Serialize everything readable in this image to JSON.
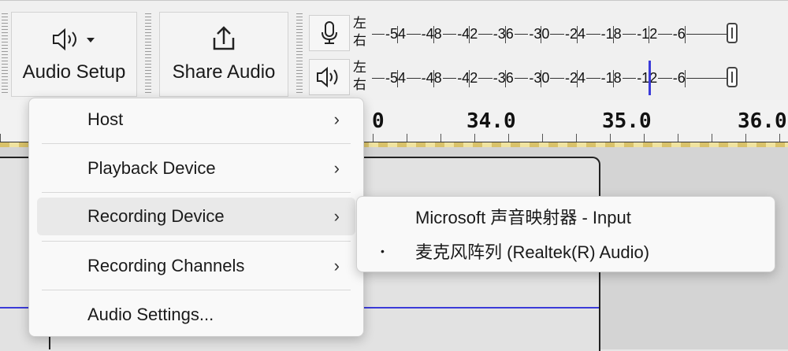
{
  "toolbar": {
    "audio_setup_label": "Audio Setup",
    "share_audio_label": "Share Audio",
    "caret": "▾"
  },
  "meters": {
    "recording": {
      "icon": "microphone-icon",
      "channels": [
        "左",
        "右"
      ]
    },
    "playback": {
      "icon": "speaker-icon",
      "channels": [
        "左",
        "右"
      ]
    },
    "scale_labels": [
      "-54",
      "-48",
      "-42",
      "-36",
      "-30",
      "-24",
      "-18",
      "-12",
      "-6"
    ],
    "playback_level_db": -12
  },
  "ruler": {
    "labels": [
      "0",
      "34.0",
      "35.0",
      "36.0"
    ]
  },
  "audio_setup_menu": {
    "items": [
      {
        "label": "Host",
        "submenu": true
      },
      {
        "label": "Playback Device",
        "submenu": true
      },
      {
        "label": "Recording Device",
        "submenu": true,
        "highlighted": true
      },
      {
        "label": "Recording Channels",
        "submenu": true
      },
      {
        "label": "Audio Settings...",
        "submenu": false
      }
    ],
    "arrow": "›"
  },
  "recording_device_submenu": {
    "items": [
      {
        "label": "Microsoft 声音映射器 - Input",
        "selected": false
      },
      {
        "label": "麦克风阵列 (Realtek(R) Audio)",
        "selected": true
      }
    ],
    "bullet": "•"
  },
  "colors": {
    "waveform": "#3b3bd9",
    "menu_bg": "#f9f9f9",
    "hover_bg": "#e9e9e9"
  }
}
